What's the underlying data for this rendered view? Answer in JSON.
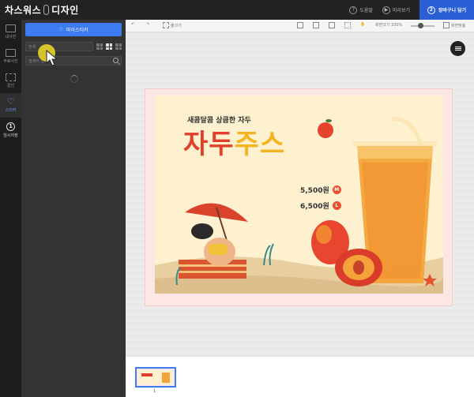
{
  "header": {
    "logo_left": "차스워스",
    "logo_right": "디자인",
    "help_label": "도움말",
    "preview_label": "미리보기",
    "cart_number": "2",
    "cart_label": "장바구니 담기"
  },
  "rail": {
    "items": [
      {
        "label": "내사진"
      },
      {
        "label": "무료사진"
      },
      {
        "label": "칼선"
      },
      {
        "label": "스티커"
      },
      {
        "label": "임시저장",
        "number": "1"
      }
    ]
  },
  "panel": {
    "sticker_button": "마이스티커",
    "sort_select": "전체",
    "search_placeholder": "검색어 입력"
  },
  "toolbar": {
    "guide_label": "물끄기",
    "zoom_label": "화면크기 100%",
    "fit_label": "화면맞춤"
  },
  "poster": {
    "subtitle": "새콤달콤 상큼한 자두",
    "title_red": "자두",
    "title_yellow": "주스",
    "prices": [
      {
        "price": "5,500원",
        "size": "M"
      },
      {
        "price": "6,500원",
        "size": "L"
      }
    ]
  },
  "pages": {
    "page_number": "1"
  },
  "colors": {
    "accent": "#3d7bf0",
    "cart": "#2a5fd6",
    "title_red": "#e0402b",
    "title_yellow": "#f3b422"
  }
}
